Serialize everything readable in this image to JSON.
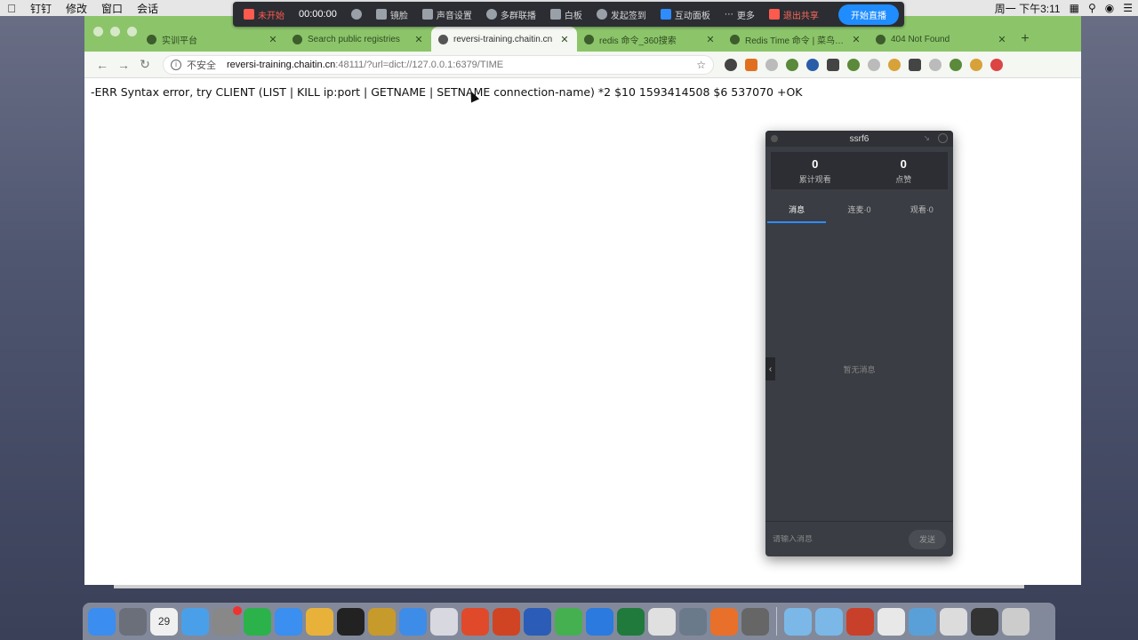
{
  "menubar": {
    "items": [
      "钉钉",
      "修改",
      "窗口",
      "会话"
    ],
    "clock": "周一 下午3:11"
  },
  "meeting_bar": {
    "status": "未开始",
    "timer": "00:00:00",
    "items": [
      "镜脸",
      "声音设置",
      "多群联播",
      "白板",
      "发起签到",
      "互动面板",
      "更多"
    ],
    "end_share": "退出共享",
    "live_button": "开始直播"
  },
  "browser": {
    "tabs": [
      {
        "label": "实训平台"
      },
      {
        "label": "Search public registries"
      },
      {
        "label": "reversi-training.chaitin.cn"
      },
      {
        "label": "redis 命令_360搜索"
      },
      {
        "label": "Redis Time 命令 | 菜鸟教程"
      },
      {
        "label": "404 Not Found"
      }
    ],
    "address": {
      "security_label": "不安全",
      "url_host": "reversi-training.chaitin.cn",
      "url_rest": ":48111/?url=dict://127.0.0.1:6379/TIME"
    },
    "page_text": "-ERR Syntax error, try CLIENT (LIST | KILL ip:port | GETNAME | SETNAME connection-name) *2 $10 1593414508 $6 537070 +OK"
  },
  "live_panel": {
    "title": "ssrf6",
    "stats": [
      {
        "value": "0",
        "label": "累计观看"
      },
      {
        "value": "0",
        "label": "点赞"
      }
    ],
    "tabs": [
      {
        "label": "消息"
      },
      {
        "label": "连麦·0"
      },
      {
        "label": "观看·0"
      }
    ],
    "empty_text": "暂无消息",
    "input_placeholder": "请输入消息",
    "send_label": "发送"
  },
  "dock": {
    "calendar_day": "29",
    "colors": [
      "#3b8df0",
      "#6b6f7a",
      "#f0f0f0",
      "#4aa0e8",
      "#888888",
      "#2cb24a",
      "#3a8ff0",
      "#e8b23a",
      "#222222",
      "#c79a2c",
      "#3d8de8",
      "#d8d8e0",
      "#e04a2a",
      "#d04423",
      "#2b5cb8",
      "#45b050",
      "#2a7ae0",
      "#1f7a3c",
      "#e0e0e0",
      "#6a7a8a",
      "#e8702a",
      "#666666",
      "#7bb8e8",
      "#7bb8e8",
      "#c8402a",
      "#e8e8e8",
      "#5aa0d8",
      "#dcdcdc",
      "#333333",
      "#cccccc"
    ]
  }
}
